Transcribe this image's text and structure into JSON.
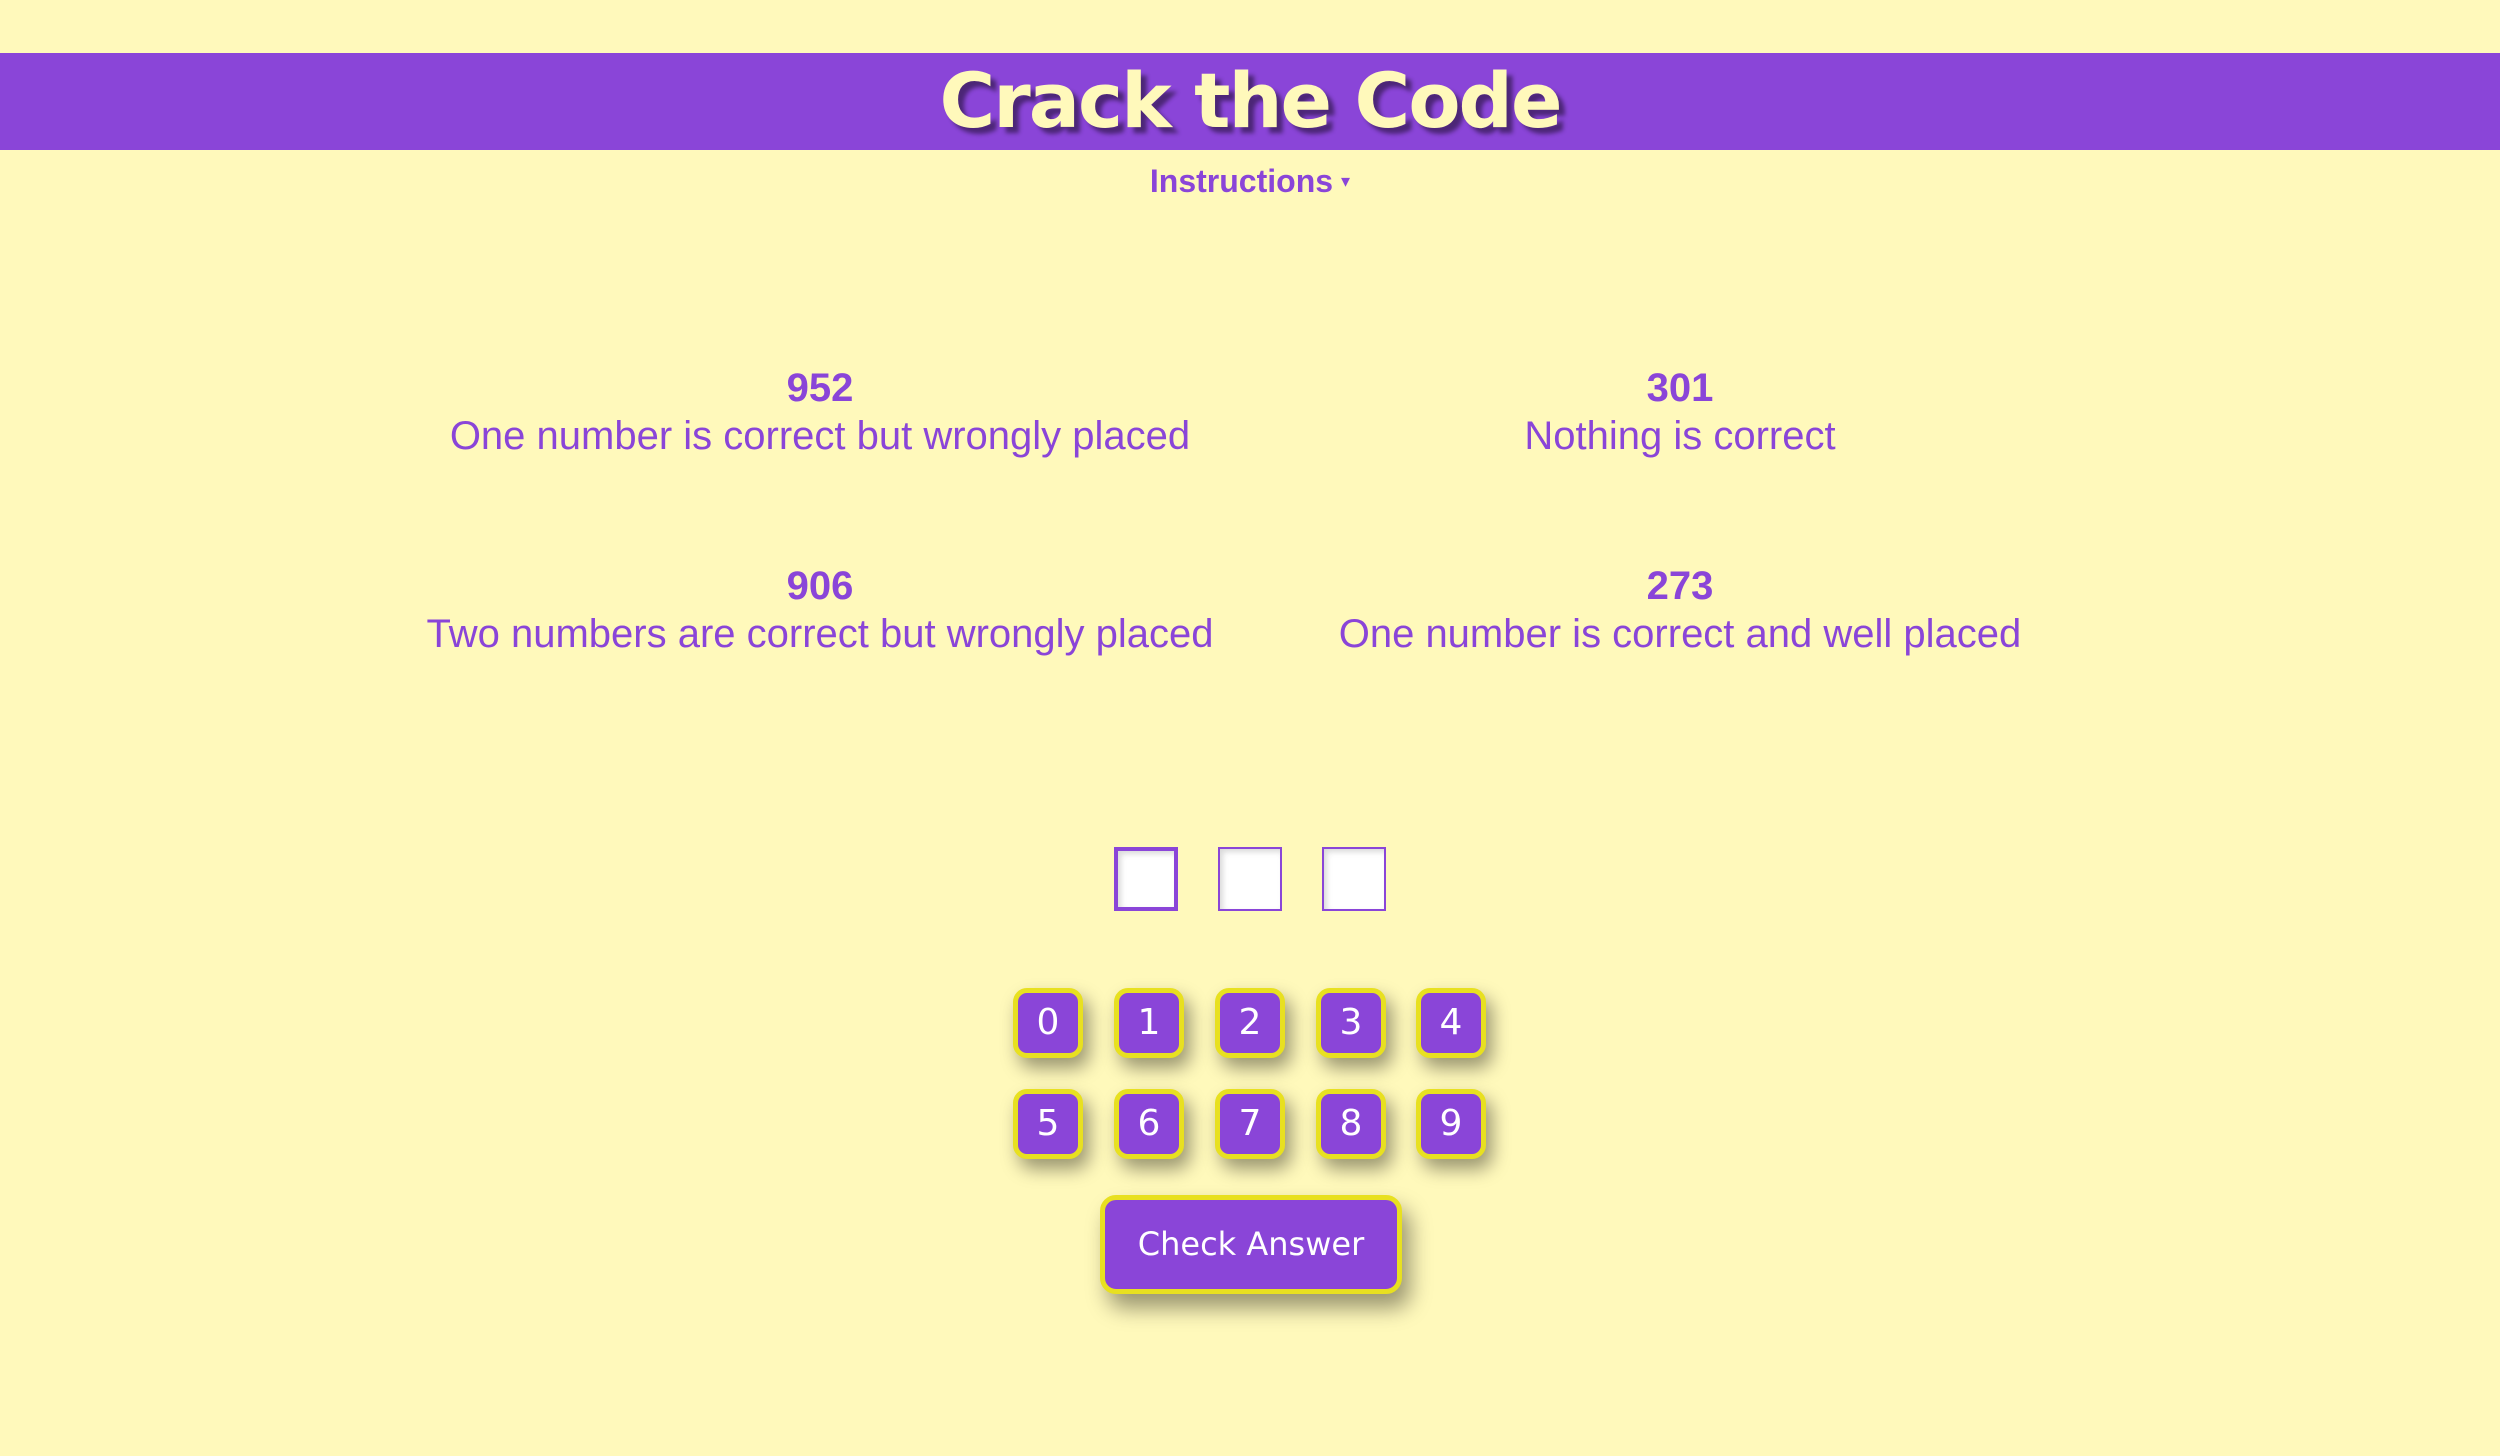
{
  "header": {
    "title": "Crack the Code",
    "instructions_label": "Instructions",
    "instructions_arrow": "▾"
  },
  "clues": [
    {
      "code": "952",
      "hint": "One number is correct but wrongly placed"
    },
    {
      "code": "301",
      "hint": "Nothing is correct"
    },
    {
      "code": "906",
      "hint": "Two numbers are correct but wrongly placed"
    },
    {
      "code": "273",
      "hint": "One number is correct and well placed"
    }
  ],
  "answer": {
    "slots": [
      "",
      "",
      ""
    ],
    "active_slot": 1
  },
  "keypad": {
    "keys": [
      "0",
      "1",
      "2",
      "3",
      "4",
      "5",
      "6",
      "7",
      "8",
      "9"
    ]
  },
  "check_button": {
    "label": "Check Answer"
  },
  "colors": {
    "background": "#fff9bb",
    "accent": "#8a45d8",
    "key_border": "#e8e020",
    "title_text": "#fff9bb"
  }
}
